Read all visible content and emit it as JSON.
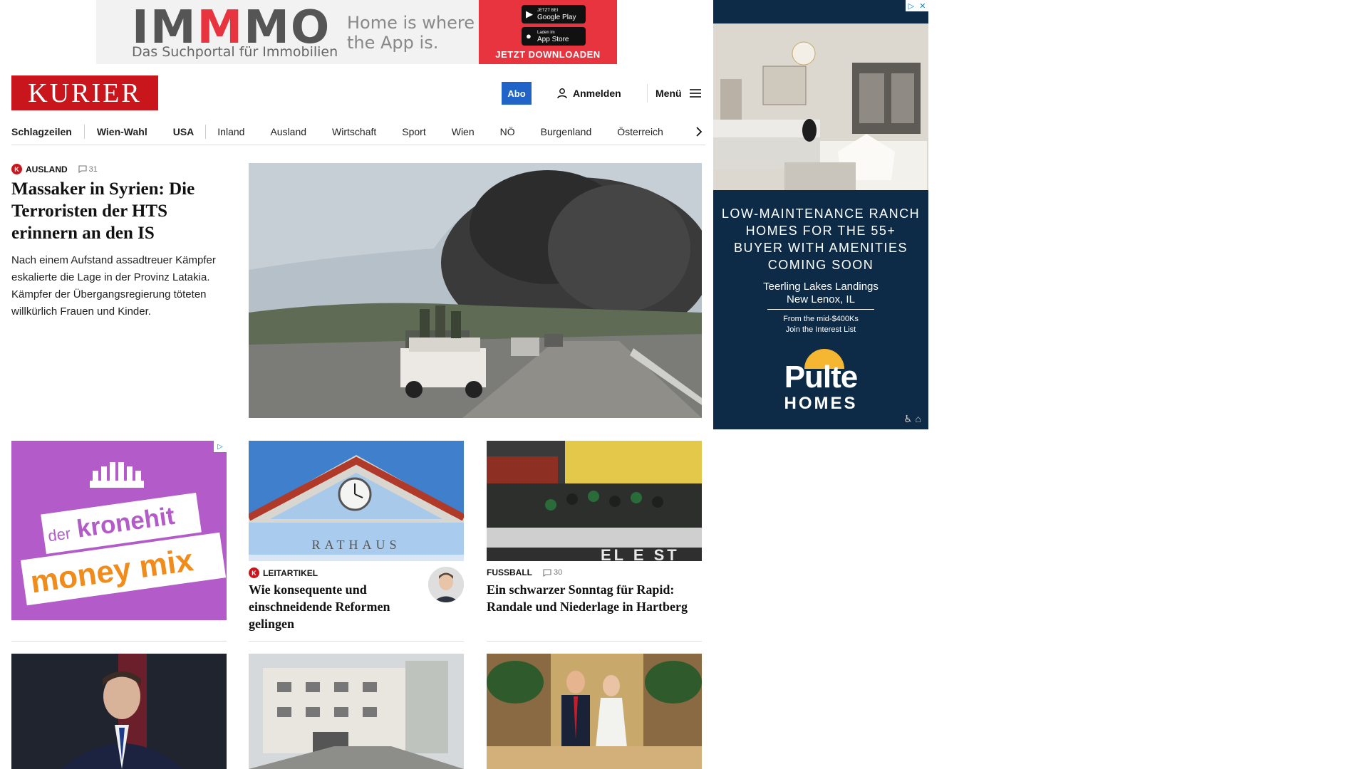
{
  "top_ad": {
    "brand": "IMMMO",
    "brand_sub": "Das Suchportal für Immobilien",
    "tagline": "Home is where the App is.",
    "google_play_small": "JETZT BEI",
    "google_play": "Google Play",
    "app_store_small": "Laden im",
    "app_store": "App Store",
    "cta": "JETZT DOWNLOADEN"
  },
  "side_ad": {
    "headline": "LOW-MAINTENANCE RANCH HOMES FOR THE 55+ BUYER WITH AMENITIES COMING SOON",
    "place_line1": "Teerling Lakes Landings",
    "place_line2": "New Lenox, IL",
    "price_line1": "From the mid-$400Ks",
    "price_line2": "Join the Interest List",
    "brand": "Pulte",
    "brand_sub": "HOMES"
  },
  "header": {
    "logo": "KURIER",
    "abo_label": "Abo",
    "login_label": "Anmelden",
    "menu_label": "Menü"
  },
  "nav": {
    "items": [
      "Schlagzeilen",
      "Wien-Wahl",
      "USA",
      "Inland",
      "Ausland",
      "Wirtschaft",
      "Sport",
      "Wien",
      "NÖ",
      "Burgenland",
      "Österreich"
    ]
  },
  "lead": {
    "kicker": "AUSLAND",
    "badge": "K",
    "comments": "31",
    "title": "Massaker in Syrien: Die Terroristen der HTS erinnern an den IS",
    "teaser": "Nach einem Aufstand assadtreuer Kämpfer eskalierte die Lage in der Provinz Latakia. Kämpfer der Übergangsregierung töteten willkürlich Frauen und Kinder."
  },
  "radio_ad": {
    "line1_small": "der",
    "line1": "kronehit",
    "line2": "money mix"
  },
  "cards": [
    {
      "image_text": "RATHAUS",
      "kicker": "LEITARTIKEL",
      "badge": "K",
      "title": "Wie konsequente und einschneidende Reformen gelingen"
    },
    {
      "image_text": "EL E ST",
      "kicker": "FUSSBALL",
      "comments": "30",
      "title": "Ein schwarzer Sonntag für Rapid: Randale und Niederlage in Hartberg"
    }
  ],
  "colors": {
    "brand_red": "#c9161d",
    "abo_blue": "#2163c7",
    "ad_navy": "#0d2b47",
    "radio_purple": "#b25bc9",
    "radio_orange": "#f08c1b",
    "immmo_red": "#e8343f"
  }
}
